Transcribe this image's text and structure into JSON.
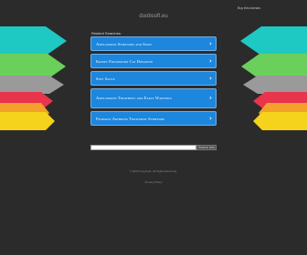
{
  "header": {
    "domain": "duobsoft.eu",
    "buy_link": "Buy this domain."
  },
  "colors": {
    "background": "#2b2b2b",
    "link_bg": "#1d86dd",
    "link_border": "#6fb0ea",
    "arrow_teal": "#1dc9c2",
    "arrow_green": "#6ad05b",
    "arrow_gray": "#9a9a9a",
    "arrow_red": "#e8344d",
    "arrow_orange": "#f3a12a",
    "arrow_yellow": "#f5d21c"
  },
  "main": {
    "related_label": "Related Searches:",
    "links": [
      "Amyloidosis Symptoms and Signs",
      "Kidney Foundation Cat Donation",
      "Soft Sauce",
      "Amyloidosis Treatment and Early Warnings",
      "Psoriatic Arthritis Treatment Symptoms"
    ],
    "search": {
      "placeholder": "",
      "button_label": "Search Ads"
    }
  },
  "footer": {
    "copyright": "© 2024 Copyright.  All Rights Reserved.",
    "privacy": "Privacy Policy"
  }
}
